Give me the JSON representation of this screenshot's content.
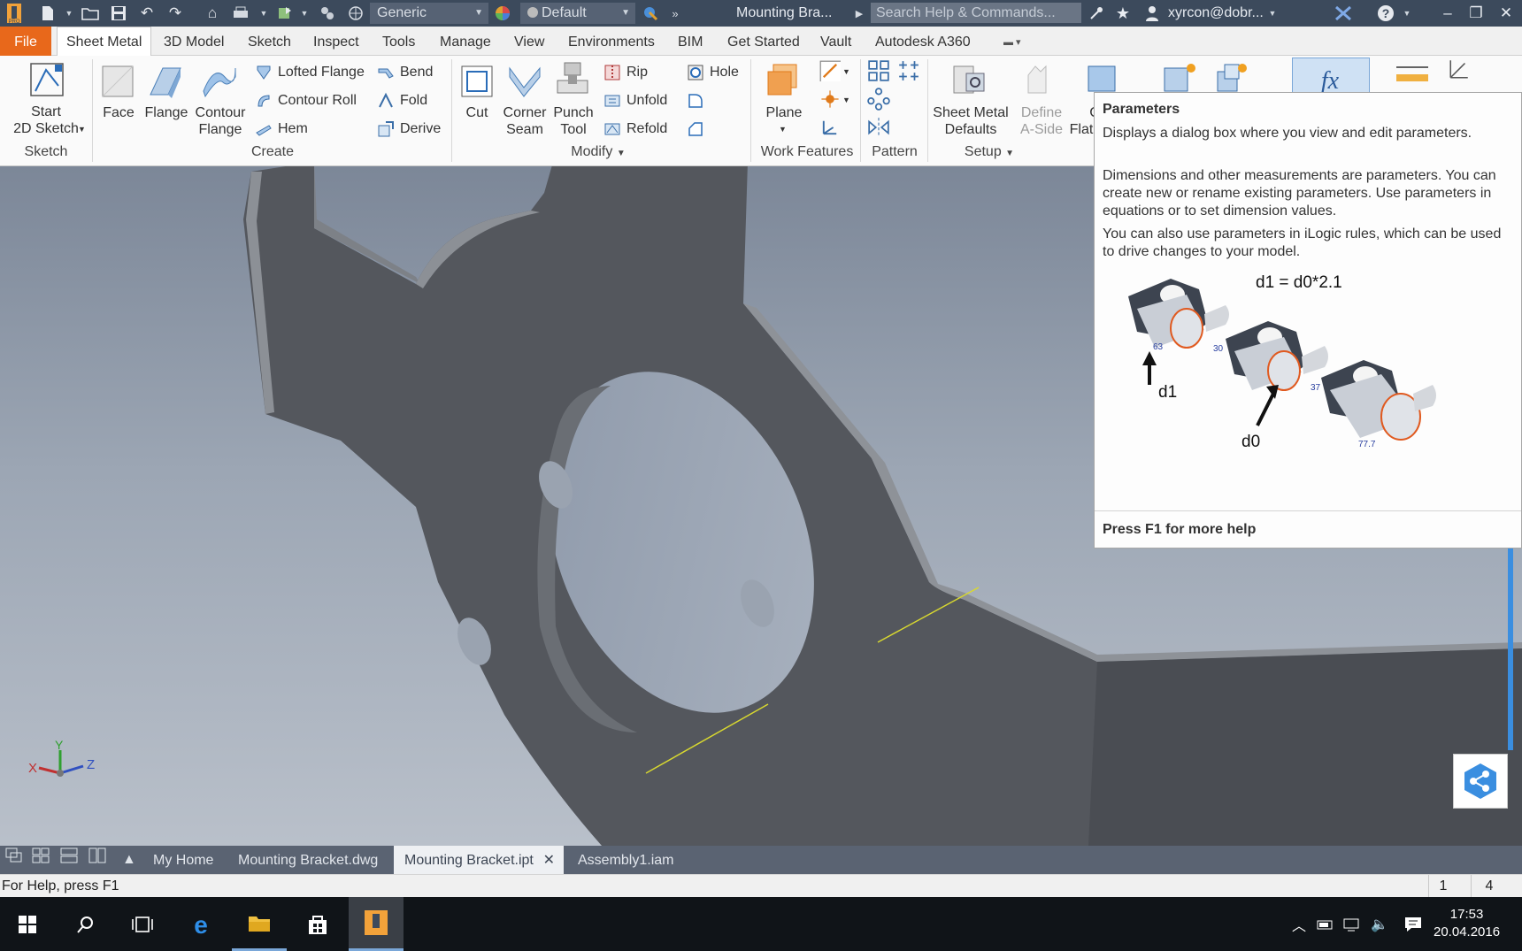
{
  "titlebar": {
    "material_combo": "Generic",
    "appearance_combo": "Default",
    "document_title": "Mounting Bra...",
    "search_placeholder": "Search Help & Commands...",
    "user": "xyrcon@dobr..."
  },
  "menu": {
    "file": "File",
    "tabs": [
      "Sheet Metal",
      "3D Model",
      "Sketch",
      "Inspect",
      "Tools",
      "Manage",
      "View",
      "Environments",
      "BIM",
      "Get Started",
      "Vault",
      "Autodesk A360"
    ]
  },
  "ribbon": {
    "sketch": {
      "start_line1": "Start",
      "start_line2": "2D Sketch",
      "group": "Sketch"
    },
    "create": {
      "face": "Face",
      "flange": "Flange",
      "contour_line1": "Contour",
      "contour_line2": "Flange",
      "lofted_flange": "Lofted Flange",
      "contour_roll": "Contour Roll",
      "hem": "Hem",
      "bend": "Bend",
      "fold": "Fold",
      "derive": "Derive",
      "group": "Create"
    },
    "modify": {
      "cut": "Cut",
      "corner_line1": "Corner",
      "corner_line2": "Seam",
      "punch_line1": "Punch",
      "punch_line2": "Tool",
      "rip": "Rip",
      "unfold": "Unfold",
      "refold": "Refold",
      "hole": "Hole",
      "group": "Modify"
    },
    "work_features": {
      "plane": "Plane",
      "group": "Work Features"
    },
    "pattern": {
      "group": "Pattern"
    },
    "setup": {
      "defaults_line1": "Sheet Metal",
      "defaults_line2": "Defaults",
      "define_line1": "Define",
      "define_line2": "A-Side",
      "flat_fragment": "Flat",
      "flat_prefix": "C",
      "group": "Setup"
    }
  },
  "tooltip": {
    "title": "Parameters",
    "line1": "Displays a dialog box where you view and edit parameters.",
    "para2": "Dimensions and other measurements are parameters. You can create new or rename existing parameters. Use parameters in equations or to set dimension values.",
    "para3": "You can also use parameters in iLogic rules, which can be used to drive changes to your model.",
    "formula": "d1 = d0*2.1",
    "label_d1": "d1",
    "label_d0": "d0",
    "dim_63": "63",
    "dim_30": "30",
    "dim_37": "37",
    "dim_777": "77.7",
    "footer": "Press F1 for more help"
  },
  "viewcube": {
    "x": "X",
    "y": "Y",
    "z": "Z"
  },
  "doc_tabs": {
    "home": "My Home",
    "tabs": [
      "Mounting Bracket.dwg",
      "Mounting Bracket.ipt",
      "Assembly1.iam"
    ],
    "active_index": 1
  },
  "status": {
    "help": "For Help, press F1",
    "count1": "1",
    "count2": "4"
  },
  "taskbar": {
    "time": "17:53",
    "date": "20.04.2016"
  },
  "colors": {
    "file_tab": "#e8681b",
    "titlebar": "#3c4a5c",
    "part": "#55585e",
    "work_axis": "#d8d830"
  }
}
